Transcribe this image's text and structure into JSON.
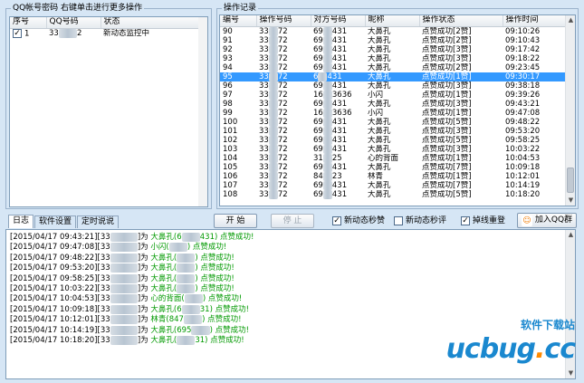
{
  "accounts_panel": {
    "title": "QQ帐号密码   右键单击进行更多操作",
    "columns": [
      "序号",
      "QQ号码",
      "状态"
    ],
    "rows": [
      {
        "checked": true,
        "index": "1",
        "qq": "33",
        "qq_suffix": "2",
        "status": "新动态监控中"
      }
    ]
  },
  "records_panel": {
    "title": "操作记录",
    "columns": [
      "编号",
      "操作号码",
      "对方号码",
      "昵称",
      "操作状态",
      "操作时间"
    ],
    "rows": [
      {
        "id": "90",
        "op": "33",
        "op_suffix": "72",
        "peer": "69",
        "peer_suffix": "431",
        "nick": "大鼻孔",
        "state": "点赞成功[2赞]",
        "time": "09:10:26"
      },
      {
        "id": "91",
        "op": "33",
        "op_suffix": "72",
        "peer": "69",
        "peer_suffix": "431",
        "nick": "大鼻孔",
        "state": "点赞成功[2赞]",
        "time": "09:10:43"
      },
      {
        "id": "92",
        "op": "33",
        "op_suffix": "72",
        "peer": "69",
        "peer_suffix": "431",
        "nick": "大鼻孔",
        "state": "点赞成功[3赞]",
        "time": "09:17:42"
      },
      {
        "id": "93",
        "op": "33",
        "op_suffix": "72",
        "peer": "69",
        "peer_suffix": "431",
        "nick": "大鼻孔",
        "state": "点赞成功[3赞]",
        "time": "09:18:22"
      },
      {
        "id": "94",
        "op": "33",
        "op_suffix": "72",
        "peer": "69",
        "peer_suffix": "431",
        "nick": "大鼻孔",
        "state": "点赞成功[2赞]",
        "time": "09:23:45"
      },
      {
        "id": "95",
        "op": "33",
        "op_suffix": "72",
        "peer": "6",
        "peer_suffix": "431",
        "nick": "大鼻孔",
        "state": "点赞成功[1赞]",
        "time": "09:30:17",
        "selected": true
      },
      {
        "id": "96",
        "op": "33",
        "op_suffix": "72",
        "peer": "69",
        "peer_suffix": "431",
        "nick": "大鼻孔",
        "state": "点赞成功[3赞]",
        "time": "09:38:18"
      },
      {
        "id": "97",
        "op": "33",
        "op_suffix": "72",
        "peer": "16",
        "peer_suffix": "3636",
        "nick": "小闪",
        "state": "点赞成功[1赞]",
        "time": "09:39:26"
      },
      {
        "id": "98",
        "op": "33",
        "op_suffix": "72",
        "peer": "69",
        "peer_suffix": "431",
        "nick": "大鼻孔",
        "state": "点赞成功[3赞]",
        "time": "09:43:21"
      },
      {
        "id": "99",
        "op": "33",
        "op_suffix": "72",
        "peer": "16",
        "peer_suffix": "3636",
        "nick": "小闪",
        "state": "点赞成功[1赞]",
        "time": "09:47:08"
      },
      {
        "id": "100",
        "op": "33",
        "op_suffix": "72",
        "peer": "69",
        "peer_suffix": "431",
        "nick": "大鼻孔",
        "state": "点赞成功[5赞]",
        "time": "09:48:22"
      },
      {
        "id": "101",
        "op": "33",
        "op_suffix": "72",
        "peer": "69",
        "peer_suffix": "431",
        "nick": "大鼻孔",
        "state": "点赞成功[3赞]",
        "time": "09:53:20"
      },
      {
        "id": "102",
        "op": "33",
        "op_suffix": "72",
        "peer": "69",
        "peer_suffix": "431",
        "nick": "大鼻孔",
        "state": "点赞成功[5赞]",
        "time": "09:58:25"
      },
      {
        "id": "103",
        "op": "33",
        "op_suffix": "72",
        "peer": "69",
        "peer_suffix": "431",
        "nick": "大鼻孔",
        "state": "点赞成功[3赞]",
        "time": "10:03:22"
      },
      {
        "id": "104",
        "op": "33",
        "op_suffix": "72",
        "peer": "31",
        "peer_suffix": "25",
        "nick": "心的背面",
        "state": "点赞成功[1赞]",
        "time": "10:04:53"
      },
      {
        "id": "105",
        "op": "33",
        "op_suffix": "72",
        "peer": "69",
        "peer_suffix": "431",
        "nick": "大鼻孔",
        "state": "点赞成功[7赞]",
        "time": "10:09:18"
      },
      {
        "id": "106",
        "op": "33",
        "op_suffix": "72",
        "peer": "84",
        "peer_suffix": "23",
        "nick": "林青",
        "state": "点赞成功[1赞]",
        "time": "10:12:01"
      },
      {
        "id": "107",
        "op": "33",
        "op_suffix": "72",
        "peer": "69",
        "peer_suffix": "431",
        "nick": "大鼻孔",
        "state": "点赞成功[7赞]",
        "time": "10:14:19"
      },
      {
        "id": "108",
        "op": "33",
        "op_suffix": "72",
        "peer": "69",
        "peer_suffix": "431",
        "nick": "大鼻孔",
        "state": "点赞成功[5赞]",
        "time": "10:18:20"
      }
    ]
  },
  "tabs": [
    "日志",
    "软件设置",
    "定时说说"
  ],
  "buttons": {
    "start": "开 始",
    "stop": "停 止",
    "join_group": "加入QQ群"
  },
  "options": [
    {
      "label": "新动态秒赞",
      "checked": true
    },
    {
      "label": "新动态秒评",
      "checked": false
    },
    {
      "label": "掉线重登",
      "checked": true
    }
  ],
  "log": [
    {
      "time": "[2015/04/17 09:43:21]",
      "prefix": "[33",
      "mid": "]为",
      "nick": "大鼻孔",
      "paren": "(6",
      "paren_end": "431)",
      "result": "点赞成功!"
    },
    {
      "time": "[2015/04/17 09:47:08]",
      "prefix": "[33",
      "mid": "]为",
      "nick": "小闪",
      "paren": "(",
      "paren_end": ")",
      "result": "点赞成功!"
    },
    {
      "time": "[2015/04/17 09:48:22]",
      "prefix": "[33",
      "mid": "]为",
      "nick": "大鼻孔",
      "paren": "(",
      "paren_end": ")",
      "result": "点赞成功!"
    },
    {
      "time": "[2015/04/17 09:53:20]",
      "prefix": "[33",
      "mid": "]为",
      "nick": "大鼻孔",
      "paren": "(",
      "paren_end": ")",
      "result": "点赞成功!"
    },
    {
      "time": "[2015/04/17 09:58:25]",
      "prefix": "[33",
      "mid": "]为",
      "nick": "大鼻孔",
      "paren": "(",
      "paren_end": ")",
      "result": "点赞成功!"
    },
    {
      "time": "[2015/04/17 10:03:22]",
      "prefix": "[33",
      "mid": "]为",
      "nick": "大鼻孔",
      "paren": "(",
      "paren_end": ")",
      "result": "点赞成功!"
    },
    {
      "time": "[2015/04/17 10:04:53]",
      "prefix": "[33",
      "mid": "]为",
      "nick": "心的背面",
      "paren": "(",
      "paren_end": ")",
      "result": "点赞成功!"
    },
    {
      "time": "[2015/04/17 10:09:18]",
      "prefix": "[33",
      "mid": "]为",
      "nick": "大鼻孔",
      "paren": "(6",
      "paren_end": "31)",
      "result": "点赞成功!"
    },
    {
      "time": "[2015/04/17 10:12:01]",
      "prefix": "[33",
      "mid": "]为",
      "nick": "林青",
      "paren": "(847",
      "paren_end": ")",
      "result": "点赞成功!"
    },
    {
      "time": "[2015/04/17 10:14:19]",
      "prefix": "[33",
      "mid": "]为",
      "nick": "大鼻孔",
      "paren": "(695",
      "paren_end": ")",
      "result": "点赞成功!"
    },
    {
      "time": "[2015/04/17 10:18:20]",
      "prefix": "[33",
      "mid": "]为",
      "nick": "大鼻孔",
      "paren": "(",
      "paren_end": "31)",
      "result": "点赞成功!"
    }
  ],
  "watermark": {
    "top": "软件下载站",
    "main": "ucbug",
    "dot": ".",
    "tld": "cc"
  },
  "colors": {
    "background": "#d6e6f5",
    "selection": "#3399ff",
    "log_success": "#009900"
  }
}
